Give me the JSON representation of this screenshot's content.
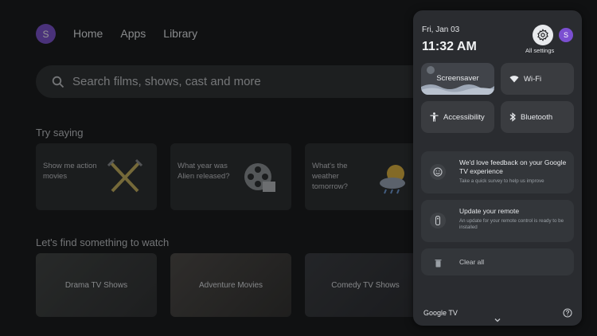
{
  "home": {
    "avatar_initial": "S",
    "nav": [
      "Home",
      "Apps",
      "Library"
    ],
    "search_placeholder": "Search films, shows, cast and more",
    "try_saying_title": "Try saying",
    "suggestions": [
      {
        "text": "Show me action movies",
        "icon": "swords-icon"
      },
      {
        "text": "What year was Alien released?",
        "icon": "film-reel-icon"
      },
      {
        "text": "What's the weather tomorrow?",
        "icon": "weather-icon"
      }
    ],
    "find_title": "Let's find something to watch",
    "genres": [
      "Drama TV Shows",
      "Adventure Movies",
      "Comedy TV Shows"
    ]
  },
  "panel": {
    "date": "Fri, Jan 03",
    "time": "11:32 AM",
    "settings_label": "All settings",
    "avatar_initial": "S",
    "quick_tiles": {
      "screensaver": "Screensaver",
      "wifi": "Wi-Fi",
      "accessibility": "Accessibility",
      "bluetooth": "Bluetooth"
    },
    "notifications": [
      {
        "title": "We'd love feedback on your Google TV experience",
        "subtitle": "Take a quick survey to help us improve",
        "icon": "smiley-icon"
      },
      {
        "title": "Update your remote",
        "subtitle": "An update for your remote control is ready to be installed",
        "icon": "remote-icon"
      }
    ],
    "clear_all": "Clear all",
    "brand": "Google TV"
  },
  "colors": {
    "accent_avatar": "#7b4fd1",
    "panel_bg": "#2a2c30",
    "tile_bg": "#3a3c40"
  }
}
